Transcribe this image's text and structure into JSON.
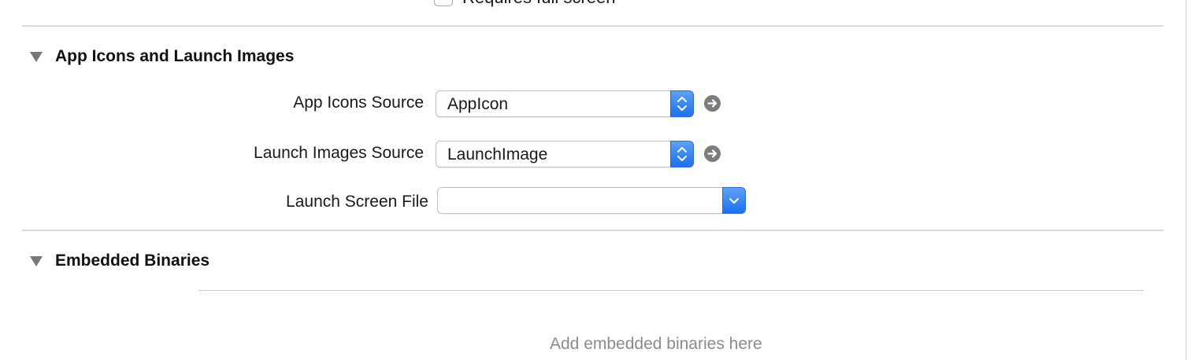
{
  "top_partial": {
    "checkbox_label": "Requires full screen"
  },
  "sections": {
    "app_icons": {
      "title": "App Icons and Launch Images",
      "rows": [
        {
          "label": "App Icons Source",
          "value": "AppIcon"
        },
        {
          "label": "Launch Images Source",
          "value": "LaunchImage"
        },
        {
          "label": "Launch Screen File",
          "value": ""
        }
      ]
    },
    "embedded_binaries": {
      "title": "Embedded Binaries",
      "empty_hint": "Add embedded binaries here"
    }
  },
  "icons": {
    "disclosure": "disclosure-triangle-down-icon",
    "stepper": "up-down-chevron-icon",
    "combo": "chevron-down-icon",
    "go": "arrow-right-circle-icon"
  },
  "colors": {
    "accent": "#1b6ff2",
    "divider": "#d9d9d9",
    "hint_text": "#8c8c8c"
  }
}
